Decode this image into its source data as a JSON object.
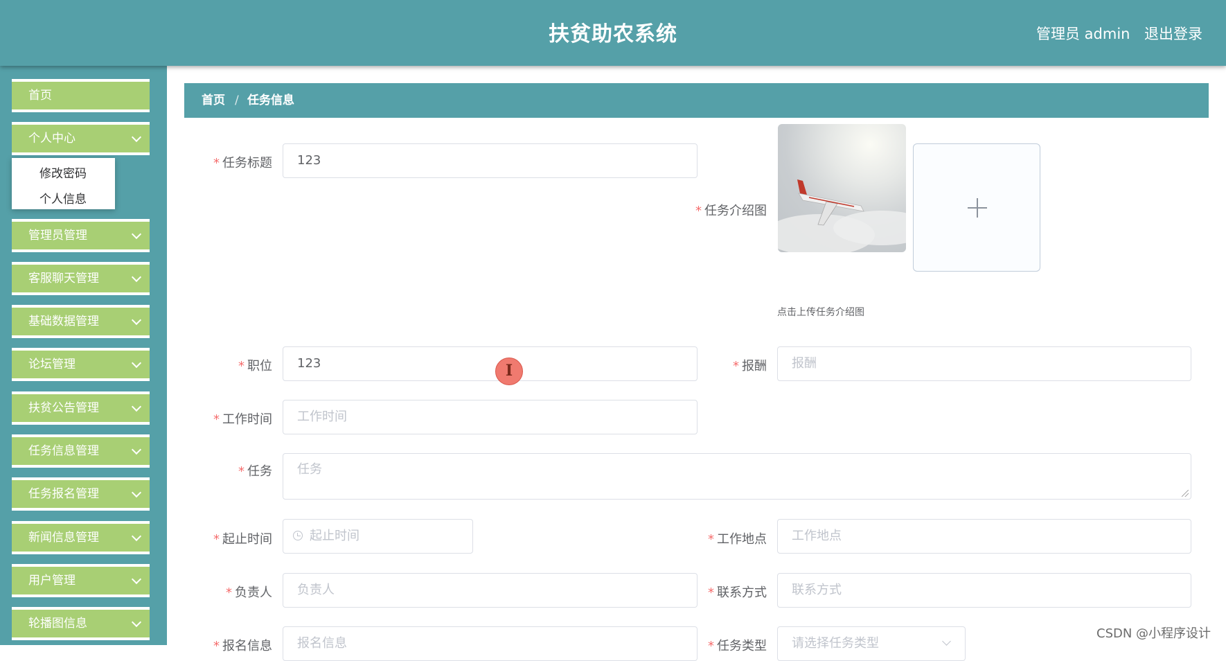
{
  "header": {
    "app_title": "扶贫助农系统",
    "admin_label": "管理员 admin",
    "logout_label": "退出登录"
  },
  "sidebar": {
    "items": [
      {
        "label": "首页"
      },
      {
        "label": "个人中心",
        "submenu": [
          "修改密码",
          "个人信息"
        ]
      },
      {
        "label": "管理员管理"
      },
      {
        "label": "客服聊天管理"
      },
      {
        "label": "基础数据管理"
      },
      {
        "label": "论坛管理"
      },
      {
        "label": "扶贫公告管理"
      },
      {
        "label": "任务信息管理"
      },
      {
        "label": "任务报名管理"
      },
      {
        "label": "新闻信息管理"
      },
      {
        "label": "用户管理"
      },
      {
        "label": "轮播图信息"
      }
    ]
  },
  "breadcrumb": {
    "home": "首页",
    "separator": "/",
    "current": "任务信息"
  },
  "form": {
    "title": {
      "label": "任务标题",
      "value": "123"
    },
    "image": {
      "label": "任务介绍图",
      "upload_hint": "点击上传任务介绍图",
      "upload_icon": "plus-icon"
    },
    "position": {
      "label": "职位",
      "value": "123"
    },
    "salary": {
      "label": "报酬",
      "placeholder": "报酬"
    },
    "work_time": {
      "label": "工作时间",
      "placeholder": "工作时间"
    },
    "task": {
      "label": "任务",
      "placeholder": "任务"
    },
    "date_range": {
      "label": "起止时间",
      "placeholder": "起止时间",
      "icon": "clock-icon"
    },
    "location": {
      "label": "工作地点",
      "placeholder": "工作地点"
    },
    "person": {
      "label": "负责人",
      "placeholder": "负责人"
    },
    "contact": {
      "label": "联系方式",
      "placeholder": "联系方式"
    },
    "enroll": {
      "label": "报名信息",
      "placeholder": "报名信息"
    },
    "task_type": {
      "label": "任务类型",
      "placeholder": "请选择任务类型"
    }
  },
  "cursor_glyph": "I",
  "watermark": "CSDN @小程序设计",
  "colors": {
    "header": "#55a0a8",
    "menu_item": "#a8cf74",
    "required_star": "#f56c6c",
    "placeholder": "#c0c4cc"
  }
}
